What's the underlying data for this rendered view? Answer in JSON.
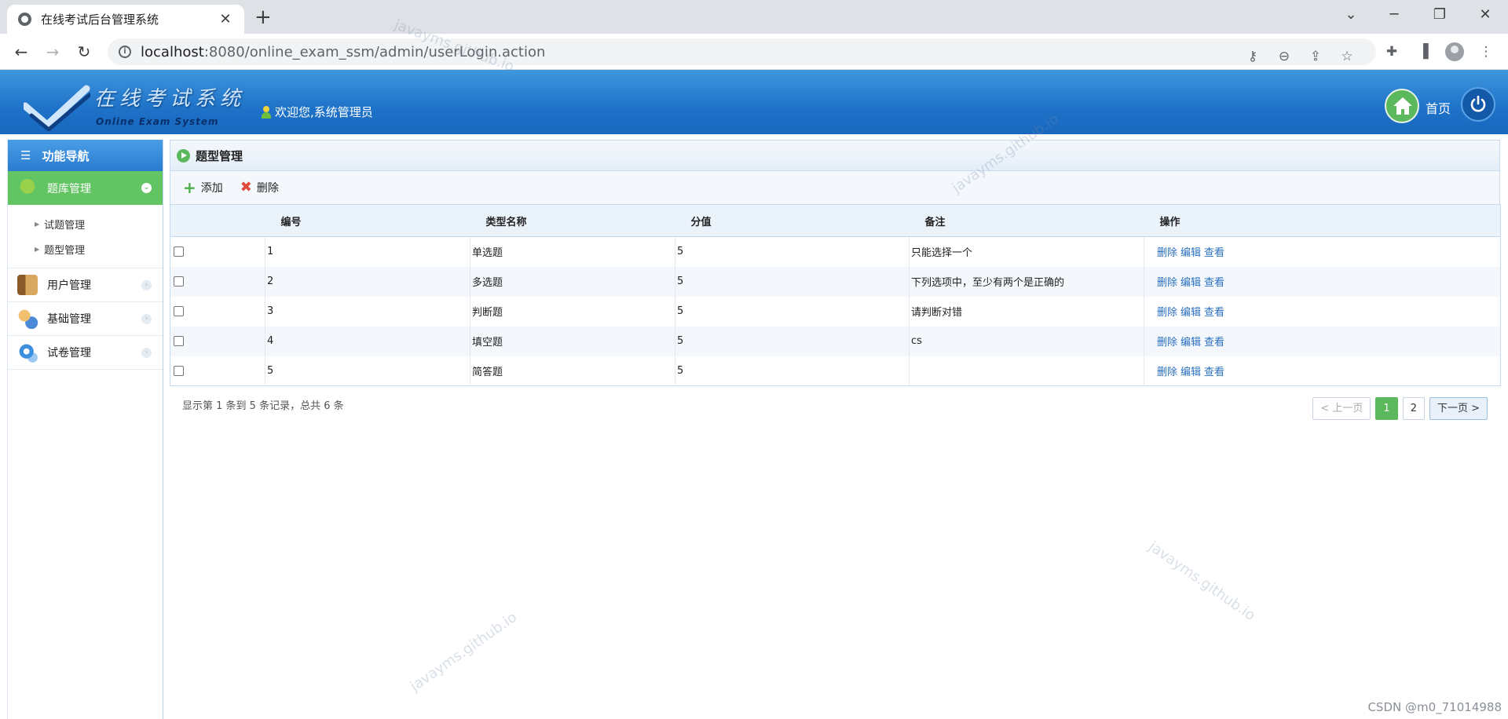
{
  "browser": {
    "tab_title": "在线考试后台管理系统",
    "close_glyph": "✕",
    "new_tab_glyph": "+",
    "url_host": "localhost",
    "url_path": ":8080/online_exam_ssm/admin/userLogin.action"
  },
  "header": {
    "logo_cn": "在线考试系统",
    "logo_en": "Online Exam System",
    "welcome": "欢迎您,系统管理员",
    "home_label": "首页"
  },
  "sidebar": {
    "title": "功能导航",
    "groups": [
      {
        "label": "题库管理",
        "active": true
      },
      {
        "label": "用户管理",
        "active": false
      },
      {
        "label": "基础管理",
        "active": false
      },
      {
        "label": "试卷管理",
        "active": false
      }
    ],
    "sub_items": [
      "试题管理",
      "题型管理"
    ]
  },
  "main": {
    "title": "题型管理",
    "toolbar": {
      "add": "添加",
      "delete": "删除"
    },
    "columns": [
      "编号",
      "类型名称",
      "分值",
      "备注",
      "操作"
    ],
    "rows": [
      {
        "id": "1",
        "name": "单选题",
        "score": "5",
        "remark": "只能选择一个"
      },
      {
        "id": "2",
        "name": "多选题",
        "score": "5",
        "remark": "下列选项中，至少有两个是正确的"
      },
      {
        "id": "3",
        "name": "判断题",
        "score": "5",
        "remark": "请判断对错"
      },
      {
        "id": "4",
        "name": "填空题",
        "score": "5",
        "remark": "cs"
      },
      {
        "id": "5",
        "name": "简答题",
        "score": "5",
        "remark": ""
      }
    ],
    "row_actions": {
      "delete": "删除",
      "edit": "编辑",
      "view": "查看"
    },
    "summary": "显示第 1 条到 5 条记录，总共 6 条",
    "pager": {
      "prev": "< 上一页",
      "page1": "1",
      "page2": "2",
      "next": "下一页 >"
    }
  },
  "watermark_text": "javayms.github.io",
  "credit": "CSDN @m0_71014988",
  "colors": {
    "header_blue": "#1e72c8",
    "accent_green": "#5cb85c",
    "link_blue": "#2a6fc0"
  }
}
